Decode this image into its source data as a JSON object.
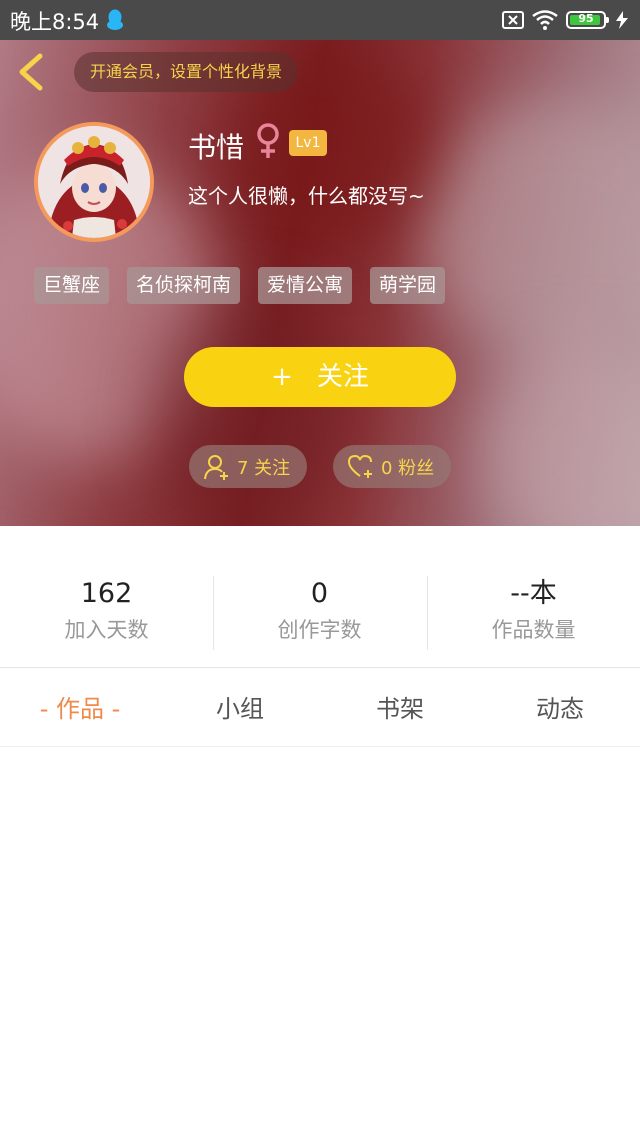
{
  "status_bar": {
    "time": "晚上8:54",
    "battery_level": "95",
    "battery_fraction": 0.95
  },
  "header": {
    "vip_promo": "开通会员，设置个性化背景",
    "username": "书惜",
    "gender_symbol": "♀",
    "level": "Lv1",
    "bio": "这个人很懒，什么都没写~",
    "tags": [
      "巨蟹座",
      "名侦探柯南",
      "爱情公寓",
      "萌学园"
    ],
    "follow_plus": "+",
    "follow_label": "关注",
    "following_text": "7 关注",
    "fans_text": "0 粉丝"
  },
  "stats": [
    {
      "value": "162",
      "label": "加入天数"
    },
    {
      "value": "0",
      "label": "创作字数"
    },
    {
      "value": "--本",
      "label": "作品数量"
    }
  ],
  "tabs": [
    {
      "label": "- 作品 -",
      "active": true
    },
    {
      "label": "小组",
      "active": false
    },
    {
      "label": "书架",
      "active": false
    },
    {
      "label": "动态",
      "active": false
    }
  ],
  "colors": {
    "accent_yellow": "#f9d311",
    "active_tab": "#f08a4b",
    "gender_pink": "#e9849a",
    "level_badge": "#f3b63f"
  }
}
